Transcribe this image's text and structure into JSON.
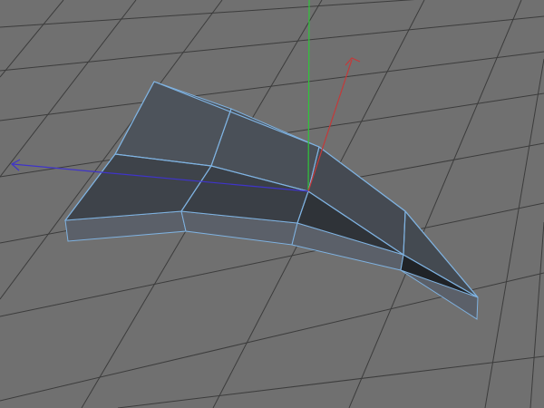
{
  "viewport": {
    "background": "#707070",
    "grid_color": "#3c3c3c",
    "mesh_face_colors": [
      "#4a5058",
      "#3a3f46",
      "#2f3338",
      "#22262a"
    ],
    "mesh_edge_color": "#7fb2e0",
    "mesh_side_color": "#5b6069"
  },
  "gizmo": {
    "axes": [
      {
        "name": "y-axis",
        "color": "#2fc43a"
      },
      {
        "name": "x-axis",
        "color": "#c33a3a"
      },
      {
        "name": "z-axis",
        "color": "#3f34c9"
      }
    ]
  },
  "tool": {
    "active": "move"
  }
}
